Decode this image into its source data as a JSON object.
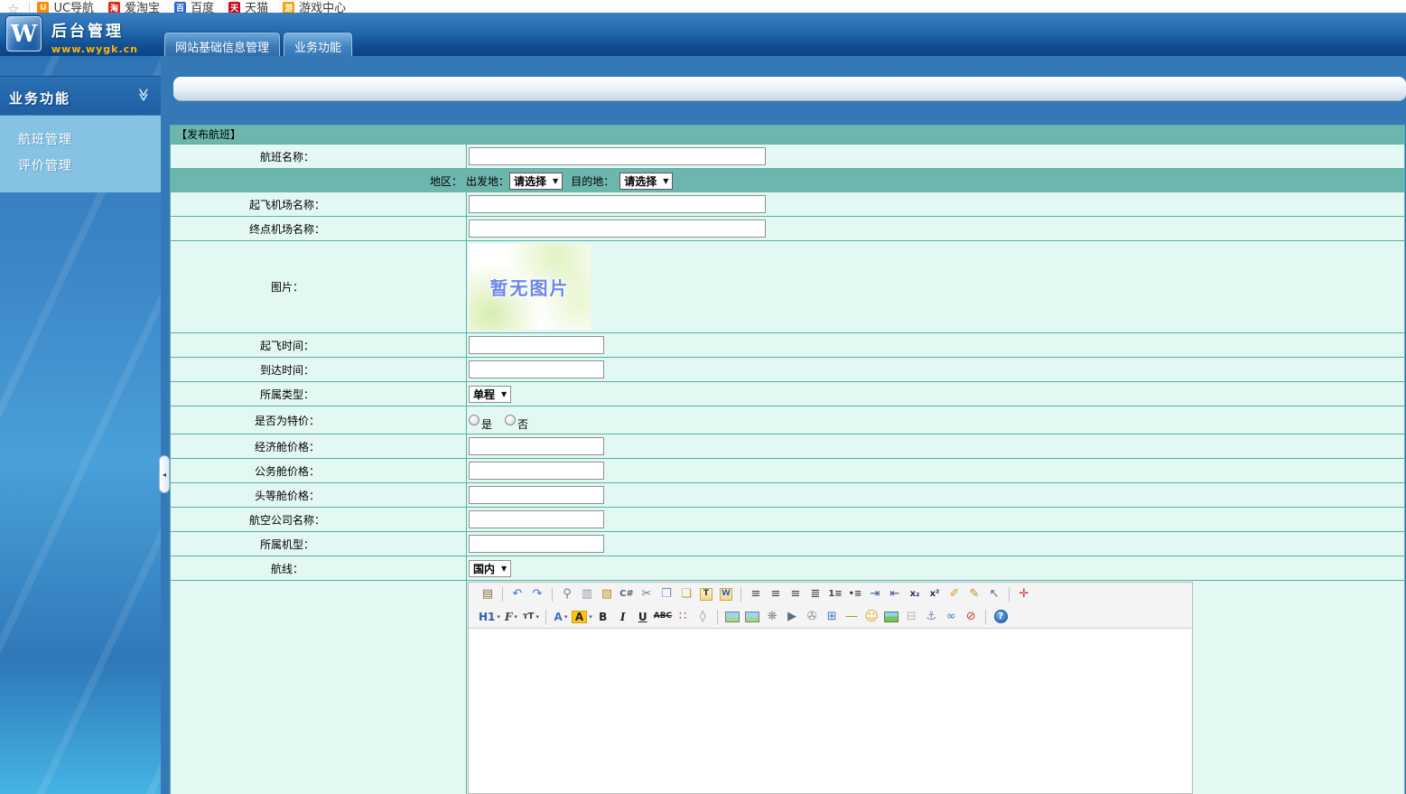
{
  "colors": {
    "header_gradient_top": "#3a80c2",
    "header_gradient_bottom": "#0e4a8c",
    "content_background": "#3478b6",
    "table_border": "#56b1a8",
    "table_header_background": "#6db6ae",
    "cell_background": "#e3f8f3",
    "sidebar_panel_background": "#86c3e3",
    "subtitle_orange": "#ffb400",
    "placeholder_text_blue": "#6d87e8"
  },
  "bookmarks_bar": {
    "star_icon": "☆",
    "items": [
      {
        "label": "UC导航"
      },
      {
        "label": "爱淘宝"
      },
      {
        "label": "百度"
      },
      {
        "label": "天猫"
      },
      {
        "label": "游戏中心"
      }
    ]
  },
  "header": {
    "logo_letter": "W",
    "title": "后台管理",
    "subtitle": "www.wygk.cn",
    "tabs": [
      {
        "label": "网站基础信息管理",
        "active": false
      },
      {
        "label": "业务功能",
        "active": true
      }
    ]
  },
  "sidebar": {
    "section_title": "业务功能",
    "collapse_icon": "≫",
    "items": [
      {
        "label": "航班管理"
      },
      {
        "label": "评价管理"
      }
    ]
  },
  "form": {
    "title": "【发布航班】",
    "labels": {
      "flight_name": "航班名称：",
      "region": "地区：",
      "depart": "出发地：",
      "destination": "目的地：",
      "depart_airport": "起飞机场名称：",
      "arrive_airport": "终点机场名称：",
      "image": "图片：",
      "depart_time": "起飞时间：",
      "arrive_time": "到达时间：",
      "trip_type": "所属类型：",
      "special_offer": "是否为特价：",
      "economy_price": "经济舱价格：",
      "business_price": "公务舱价格：",
      "first_class_price": "头等舱价格：",
      "airline_name": "航空公司名称：",
      "aircraft_model": "所属机型：",
      "route": "航线："
    },
    "values": {
      "depart_select": "请选择",
      "destination_select": "请选择",
      "trip_type_select": "单程",
      "route_select": "国内",
      "special_yes": "是",
      "special_no": "否"
    },
    "image_placeholder_text": "暂无图片"
  },
  "editor": {
    "toolbar_row1": [
      {
        "name": "view-source-icon",
        "glyph": "▤",
        "color": "#8a7040"
      },
      {
        "sep": true
      },
      {
        "name": "undo-icon",
        "glyph": "↶",
        "color": "#3b74c7"
      },
      {
        "name": "redo-icon",
        "glyph": "↷",
        "color": "#3b74c7"
      },
      {
        "sep": true
      },
      {
        "name": "print-preview-icon",
        "glyph": "⚲",
        "color": "#6b7b8d"
      },
      {
        "name": "print-icon",
        "glyph": "▥",
        "color": "#8d9aa8"
      },
      {
        "name": "template-icon",
        "glyph": "▧",
        "color": "#c08a1e"
      },
      {
        "name": "code-csharp-icon",
        "glyph": "C#",
        "cls": "txt tiny",
        "color": "#556677"
      },
      {
        "name": "cut-icon",
        "glyph": "✂",
        "color": "#6b7b8d"
      },
      {
        "name": "copy-icon",
        "glyph": "❐",
        "color": "#6b8bc7"
      },
      {
        "name": "paste-icon",
        "glyph": "❏",
        "color": "#c09a3e"
      },
      {
        "name": "paste-text-icon",
        "glyph": "T",
        "cls": "chip-paste"
      },
      {
        "name": "paste-word-icon",
        "glyph": "W",
        "cls": "chip-paste w"
      },
      {
        "sep": true
      },
      {
        "name": "align-left-icon",
        "glyph": "≡",
        "color": "#444444"
      },
      {
        "name": "align-center-icon",
        "glyph": "≡",
        "color": "#444444"
      },
      {
        "name": "align-right-icon",
        "glyph": "≡",
        "color": "#444444"
      },
      {
        "name": "align-justify-icon",
        "glyph": "≣",
        "color": "#444444"
      },
      {
        "name": "ordered-list-icon",
        "glyph": "1≡",
        "cls": "tiny",
        "color": "#444444"
      },
      {
        "name": "bullet-list-icon",
        "glyph": "•≡",
        "cls": "tiny",
        "color": "#444444"
      },
      {
        "name": "indent-icon",
        "glyph": "⇥",
        "color": "#3b5b7d"
      },
      {
        "name": "outdent-icon",
        "glyph": "⇤",
        "color": "#3b5b7d"
      },
      {
        "name": "subscript-icon",
        "glyph": "x₂",
        "cls": "txt tiny",
        "color": "#223355"
      },
      {
        "name": "superscript-icon",
        "glyph": "x²",
        "cls": "txt tiny",
        "color": "#223355"
      },
      {
        "name": "format-brush-icon",
        "glyph": "✐",
        "color": "#d49a2a"
      },
      {
        "name": "edit-note-icon",
        "glyph": "✎",
        "color": "#c08a1e"
      },
      {
        "name": "select-cursor-icon",
        "glyph": "↖",
        "color": "#5a6b7d"
      },
      {
        "sep": true
      },
      {
        "name": "fullscreen-icon",
        "glyph": "✛",
        "color": "#c0392b"
      }
    ],
    "toolbar_row2": [
      {
        "name": "heading-format-icon",
        "glyph": "H1",
        "cls": "txt",
        "color": "#2b5fb0",
        "dd": true
      },
      {
        "name": "font-family-icon",
        "glyph": "F",
        "cls": "txt serifF",
        "color": "#444444",
        "dd": true
      },
      {
        "name": "font-size-icon",
        "glyph": "тT",
        "cls": "txt tiny",
        "color": "#444444",
        "dd": true
      },
      {
        "sep": true
      },
      {
        "name": "text-color-icon",
        "glyph": "A",
        "cls": "txt",
        "color": "#3b74c7",
        "dd": true
      },
      {
        "name": "highlight-color-icon",
        "glyph": "A",
        "cls": "txt hl",
        "color": "#222222",
        "dd": true
      },
      {
        "name": "bold-icon",
        "glyph": "B",
        "cls": "txt",
        "color": "#222222"
      },
      {
        "name": "italic-icon",
        "glyph": "I",
        "cls": "txt i",
        "color": "#222222"
      },
      {
        "name": "underline-icon",
        "glyph": "U",
        "cls": "txt u",
        "color": "#222222"
      },
      {
        "name": "strikethrough-icon",
        "glyph": "ABC",
        "cls": "txt strike",
        "color": "#222222"
      },
      {
        "name": "line-spacing-icon",
        "glyph": "∷",
        "color": "#a04828"
      },
      {
        "name": "remove-format-icon",
        "glyph": "◊",
        "color": "#7d8fa6"
      },
      {
        "sep": true
      },
      {
        "name": "insert-image-icon",
        "cls": "chip-img",
        "glyph": ""
      },
      {
        "name": "insert-multi-image-icon",
        "cls": "chip-img",
        "glyph": ""
      },
      {
        "name": "insert-flash-icon",
        "glyph": "❋",
        "color": "#888888"
      },
      {
        "name": "insert-media-icon",
        "glyph": "▶",
        "color": "#5a6b7d"
      },
      {
        "name": "attachment-icon",
        "glyph": "✇",
        "color": "#8a8a8a"
      },
      {
        "name": "insert-table-icon",
        "glyph": "⊞",
        "color": "#3b74c7"
      },
      {
        "name": "horizontal-rule-icon",
        "glyph": "―",
        "color": "#c08a1e"
      },
      {
        "name": "emoticon-icon",
        "glyph": "☺",
        "cls": "smiley",
        "color": "#e8a617"
      },
      {
        "name": "insert-gallery-icon",
        "cls": "chip-img2",
        "glyph": ""
      },
      {
        "name": "save-icon",
        "glyph": "⊟",
        "color": "#b9b9b9"
      },
      {
        "name": "anchor-icon",
        "glyph": "⚓",
        "color": "#7d8fa6"
      },
      {
        "name": "link-icon",
        "glyph": "∞",
        "color": "#3b74c7"
      },
      {
        "name": "unlink-icon",
        "glyph": "⊘",
        "color": "#c0452e"
      },
      {
        "sep": true
      },
      {
        "name": "help-icon",
        "glyph": "?",
        "cls": "chip-help"
      }
    ]
  }
}
